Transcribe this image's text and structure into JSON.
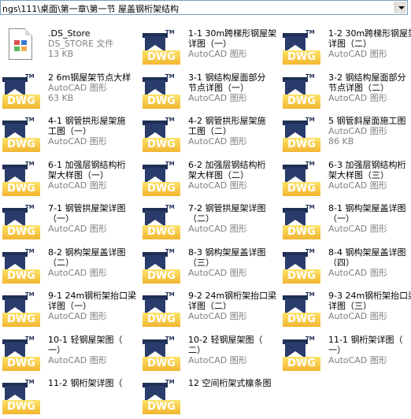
{
  "address_bar": {
    "path": "ngs\\111\\桌面\\第一章\\第一节 屋盖钢桁架结构"
  },
  "icon_label": "DWG",
  "icon_tm": "TM",
  "items": [
    {
      "type": "file",
      "line1": ".DS_Store",
      "line2": "DS_STORE 文件",
      "line3": "13 KB"
    },
    {
      "type": "dwg",
      "line1": "1-1 30m跨梯形钢屋架",
      "line2": "详图（一）",
      "line3": "AutoCAD 图形"
    },
    {
      "type": "dwg",
      "line1": "1-2 30m跨梯形钢屋架",
      "line2": "详图（二）",
      "line3": "AutoCAD 图形"
    },
    {
      "type": "dwg",
      "line1": "2 6m钢屋架节点大样",
      "line2": "AutoCAD 图形",
      "line3": "63 KB"
    },
    {
      "type": "dwg",
      "line1": "3-1 钢结构屋面部分",
      "line2": "节点详图（一）",
      "line3": "AutoCAD 图形"
    },
    {
      "type": "dwg",
      "line1": "3-2 钢结构屋面部分",
      "line2": "节点详图（二）",
      "line3": "AutoCAD 图形"
    },
    {
      "type": "dwg",
      "line1": "4-1 钢管拱形屋架施",
      "line2": "工图（一）",
      "line3": "AutoCAD 图形"
    },
    {
      "type": "dwg",
      "line1": "4-2 钢管拱形屋架施",
      "line2": "工图（二）",
      "line3": "AutoCAD 图形"
    },
    {
      "type": "dwg",
      "line1": "5 钢管斜屋面施工图",
      "line2": "AutoCAD 图形",
      "line3": "86 KB"
    },
    {
      "type": "dwg",
      "line1": "6-1 加强层钢结构桁",
      "line2": "架大样图（一）",
      "line3": "AutoCAD 图形"
    },
    {
      "type": "dwg",
      "line1": "6-2 加强层钢结构桁",
      "line2": "架大样图（二）",
      "line3": "AutoCAD 图形"
    },
    {
      "type": "dwg",
      "line1": "6-3 加强层钢结构桁",
      "line2": "架大样图（三）",
      "line3": "AutoCAD 图形"
    },
    {
      "type": "dwg",
      "line1": "7-1 钢管拱屋架详图",
      "line2": "（一）",
      "line3": "AutoCAD 图形"
    },
    {
      "type": "dwg",
      "line1": "7-2 钢管拱屋架详图",
      "line2": "（二）",
      "line3": "AutoCAD 图形"
    },
    {
      "type": "dwg",
      "line1": "8-1 钢构架屋盖详图",
      "line2": "（一）",
      "line3": "AutoCAD 图形"
    },
    {
      "type": "dwg",
      "line1": "8-2 钢构架屋盖详图",
      "line2": "（二）",
      "line3": "AutoCAD 图形"
    },
    {
      "type": "dwg",
      "line1": "8-3 钢构架屋盖详图",
      "line2": "（三）",
      "line3": "AutoCAD 图形"
    },
    {
      "type": "dwg",
      "line1": "8-4 钢构架屋盖详图",
      "line2": "（四）",
      "line3": "AutoCAD 图形"
    },
    {
      "type": "dwg",
      "line1": "9-1 24m钢桁架抬口梁",
      "line2": "详图（一）",
      "line3": "AutoCAD 图形"
    },
    {
      "type": "dwg",
      "line1": "9-2 24m钢桁架抬口梁",
      "line2": "详图（二）",
      "line3": "AutoCAD 图形"
    },
    {
      "type": "dwg",
      "line1": "9-3 24m钢桁架抬口梁",
      "line2": "详图（三）",
      "line3": "AutoCAD 图形"
    },
    {
      "type": "dwg",
      "line1": "10-1 轻钢屋架图（",
      "line2": "一）",
      "line3": "AutoCAD 图形"
    },
    {
      "type": "dwg",
      "line1": "10-2 轻钢屋架图（",
      "line2": "二）",
      "line3": "AutoCAD 图形"
    },
    {
      "type": "dwg",
      "line1": "11-1 钢桁架详图（",
      "line2": "一）",
      "line3": "AutoCAD 图形"
    },
    {
      "type": "dwg",
      "line1": "11-2 钢桁架详图（",
      "line2": "",
      "line3": ""
    },
    {
      "type": "dwg",
      "line1": "12 空间桁架式檩条图",
      "line2": "",
      "line3": ""
    }
  ]
}
